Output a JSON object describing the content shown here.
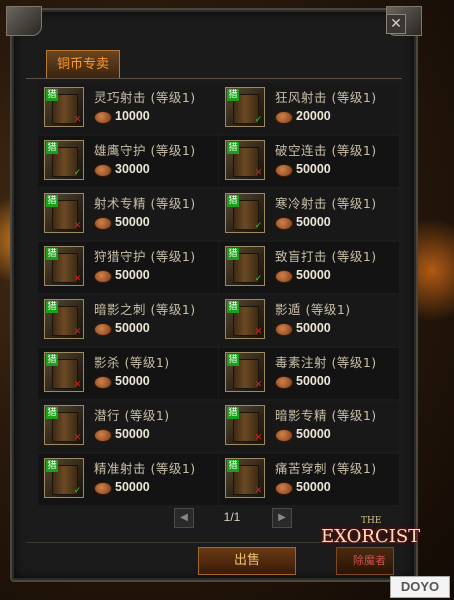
{
  "window": {
    "close_label": "✕",
    "tab_label": "铜币专卖"
  },
  "skills": [
    {
      "name": "灵巧射击 (等级1)",
      "price": "10000",
      "status": "no"
    },
    {
      "name": "狂风射击 (等级1)",
      "price": "20000",
      "status": "ok"
    },
    {
      "name": "雄鹰守护 (等级1)",
      "price": "30000",
      "status": "ok"
    },
    {
      "name": "破空连击 (等级1)",
      "price": "50000",
      "status": "no"
    },
    {
      "name": "射术专精 (等级1)",
      "price": "50000",
      "status": "no"
    },
    {
      "name": "寒冷射击 (等级1)",
      "price": "50000",
      "status": "ok"
    },
    {
      "name": "狩猎守护 (等级1)",
      "price": "50000",
      "status": "no"
    },
    {
      "name": "致盲打击 (等级1)",
      "price": "50000",
      "status": "ok"
    },
    {
      "name": "暗影之刺 (等级1)",
      "price": "50000",
      "status": "no"
    },
    {
      "name": "影遁 (等级1)",
      "price": "50000",
      "status": "no"
    },
    {
      "name": "影杀 (等级1)",
      "price": "50000",
      "status": "no"
    },
    {
      "name": "毒素注射 (等级1)",
      "price": "50000",
      "status": "no"
    },
    {
      "name": "潜行 (等级1)",
      "price": "50000",
      "status": "no"
    },
    {
      "name": "暗影专精 (等级1)",
      "price": "50000",
      "status": "no"
    },
    {
      "name": "精准射击 (等级1)",
      "price": "50000",
      "status": "ok"
    },
    {
      "name": "痛苦穿刺 (等级1)",
      "price": "50000",
      "status": "no"
    }
  ],
  "book_tag": "猎",
  "pager": {
    "prev": "◀",
    "label": "1/1",
    "next": "▶"
  },
  "actions": {
    "sell_label": "出售"
  },
  "logo": {
    "the": "THE",
    "main": "EXORCIST",
    "sub": "除魔者"
  },
  "watermark": "DOYO",
  "quest_marker": "!",
  "colors": {
    "tab_text": "#ff9a2a",
    "status_ok": "#30d030",
    "status_no": "#e02020"
  }
}
